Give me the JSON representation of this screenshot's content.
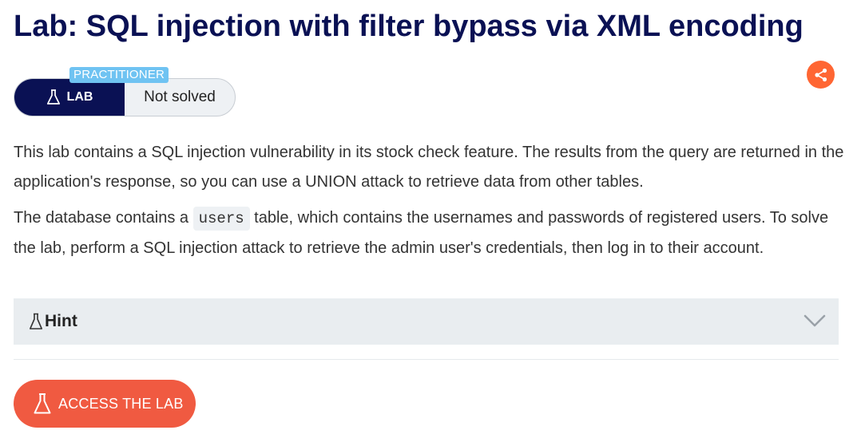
{
  "title": "Lab: SQL injection with filter bypass via XML encoding",
  "status": {
    "level_badge": "PRACTITIONER",
    "lab_label": "LAB",
    "state": "Not solved"
  },
  "description": {
    "paragraph1": "This lab contains a SQL injection vulnerability in its stock check feature. The results from the query are returned in the application's response, so you can use a UNION attack to retrieve data from other tables.",
    "paragraph2_before": "The database contains a ",
    "paragraph2_code": "users",
    "paragraph2_after": " table, which contains the usernames and passwords of registered users. To solve the lab, perform a SQL injection attack to retrieve the admin user's credentials, then log in to their account."
  },
  "hint": {
    "label": "Hint"
  },
  "access_button": {
    "label": "ACCESS THE LAB"
  },
  "icons": {
    "share": "share-icon",
    "flask": "flask-icon",
    "chevron": "chevron-down-icon"
  },
  "colors": {
    "title": "#0a1154",
    "lab_pill_dark": "#0a1154",
    "level_badge": "#6fc3f2",
    "share_button": "#ff6633",
    "access_button": "#f05a41",
    "hint_background": "#e9edf0"
  }
}
